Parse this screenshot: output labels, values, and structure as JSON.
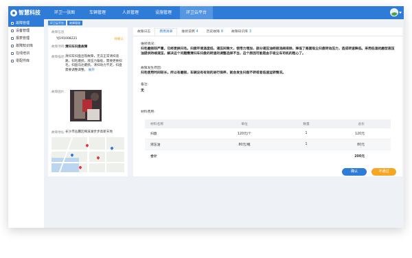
{
  "app": {
    "logo_text": "智慧科技"
  },
  "topnav": [
    {
      "label": "环卫一张图",
      "active": false
    },
    {
      "label": "车辆管理",
      "active": false
    },
    {
      "label": "人员管理",
      "active": false
    },
    {
      "label": "设施管理",
      "active": false
    },
    {
      "label": "环卫云平台",
      "active": true
    }
  ],
  "sidebar": [
    {
      "label": "故障管理",
      "active": true,
      "icon": "monitor-icon"
    },
    {
      "label": "设备管理",
      "active": false,
      "icon": "device-icon"
    },
    {
      "label": "报表管理",
      "active": false,
      "icon": "report-icon"
    },
    {
      "label": "故障知识库",
      "active": false,
      "icon": "library-icon"
    },
    {
      "label": "在线培训",
      "active": false,
      "icon": "training-icon"
    },
    {
      "label": "零配件库",
      "active": false,
      "icon": "parts-icon"
    }
  ],
  "breadcrumbs": [
    "环卫云平台",
    "故障管理"
  ],
  "fault": {
    "header": "故障信息",
    "id": "YJ191008221",
    "status": "待确认",
    "project_label": "故障项目:",
    "project_value": "清扫车扫盘故障",
    "desc_label": "故障描述:",
    "desc_value": "清扫车扫盘出现故障，无法正常清扫道路。扫毛磨损，液压力偏低，需要更换扫毛。扫盘马达磨损，清扫动力不足，扫盘需要调整调整。",
    "more": "展开",
    "photo_label": "故障图片:",
    "addr_label": "故障地址:",
    "addr_value": "长沙市岳麓区梅溪湖步步高新天地"
  },
  "tabs": [
    {
      "label": "故障日志",
      "count": "",
      "active": false
    },
    {
      "label": "费用清单",
      "count": "",
      "active": true
    },
    {
      "label": "维修说明",
      "count": "4",
      "active": false
    },
    {
      "label": "历史故障",
      "count": "8",
      "active": false
    },
    {
      "label": "故障知识库",
      "count": "3",
      "active": false
    }
  ],
  "detail": {
    "repair_label": "维修情况:",
    "repair_text": "扫毛磨损较严重，已经更换扫毛。扫盘环境温度低，液压间隙大，使用力增加，部分液压油经接流阀排除，降低了路面吸尘扫盘转动压力，造成转速降低。采用低温抗磨型液压油提供持续液压，解决这个问题需清扫车扫盘的转速的调整选择不当，这个原因可能是由于吸尘车司机的粗心了。",
    "cause_label": "故障发生原因:",
    "cause_text": "扫毛使用时间较长，所以有磨损，车辆没有有效的进行保养，就会发生扫盘不转或者低速运转情况。",
    "remark_label": "备注:",
    "remark_value": "无",
    "cost_label": "材料费用:"
  },
  "cost_table": {
    "headers": [
      "材料名称",
      "单位",
      "数量",
      "总价"
    ],
    "rows": [
      [
        "扫盘",
        "120元/个",
        "1",
        "120元"
      ],
      [
        "液压油",
        "80元/瓶",
        "1",
        "80元"
      ]
    ],
    "total_label": "合计",
    "total_value": "200元"
  },
  "buttons": {
    "confirm": "确认",
    "return": "不通过"
  }
}
